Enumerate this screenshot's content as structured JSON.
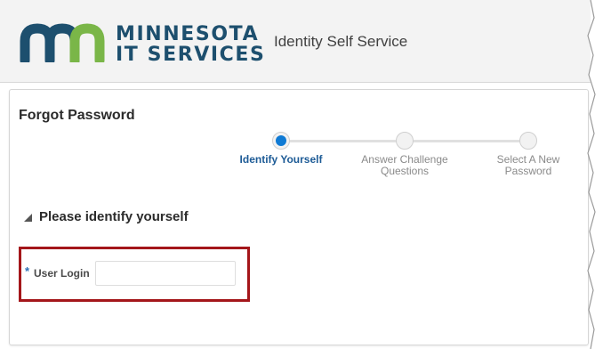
{
  "header": {
    "brand_line1": "MINNESOTA",
    "brand_line2": "IT SERVICES",
    "app_title": "Identity Self Service"
  },
  "page": {
    "title": "Forgot Password"
  },
  "train": {
    "steps": [
      {
        "label": "Identify Yourself",
        "state": "current"
      },
      {
        "label": "Answer Challenge Questions",
        "state": "pending"
      },
      {
        "label": "Select A New Password",
        "state": "pending"
      }
    ]
  },
  "section": {
    "title": "Please identify yourself"
  },
  "form": {
    "required_marker": "*",
    "user_login_label": "User Login",
    "user_login_value": ""
  },
  "colors": {
    "brand_navy": "#1d4f6e",
    "brand_green": "#7ab648",
    "accent_blue": "#0f7ad4",
    "highlight_red": "#a4161a"
  }
}
